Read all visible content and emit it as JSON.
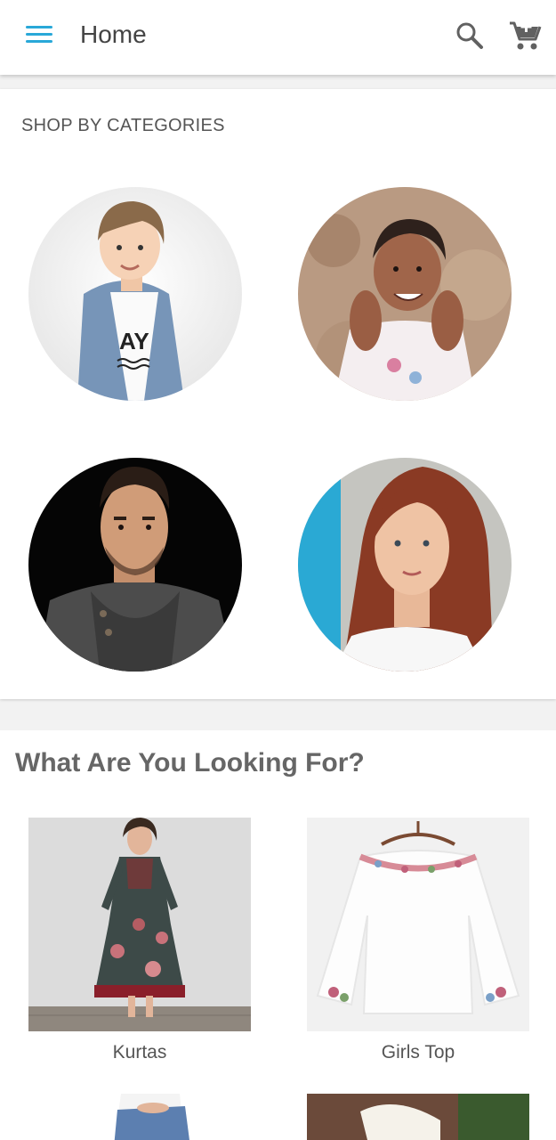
{
  "header": {
    "title": "Home",
    "menu_icon": "hamburger-menu-icon",
    "search_icon": "search-icon",
    "cart_icon": "add-shopping-cart-icon"
  },
  "colors": {
    "accent": "#29a8d8",
    "icon_gray": "#616161",
    "text_dark": "#444444",
    "text_muted": "#555555",
    "title_gray": "#666666",
    "background": "#f2f2f2"
  },
  "categories": {
    "title": "SHOP BY CATEGORIES",
    "items": [
      {
        "image": "boy-denim-jacket-photo"
      },
      {
        "image": "smiling-girl-photo"
      },
      {
        "image": "man-knit-sweater-photo"
      },
      {
        "image": "red-haired-woman-photo"
      }
    ]
  },
  "looking": {
    "title": "What Are You Looking For?",
    "products": [
      {
        "label": "Kurtas",
        "image": "floral-kurta-photo"
      },
      {
        "label": "Girls Top",
        "image": "white-embroidered-top-photo"
      }
    ],
    "partial_products": [
      {
        "image": "jeans-photo"
      },
      {
        "image": "shoes-photo"
      }
    ]
  }
}
